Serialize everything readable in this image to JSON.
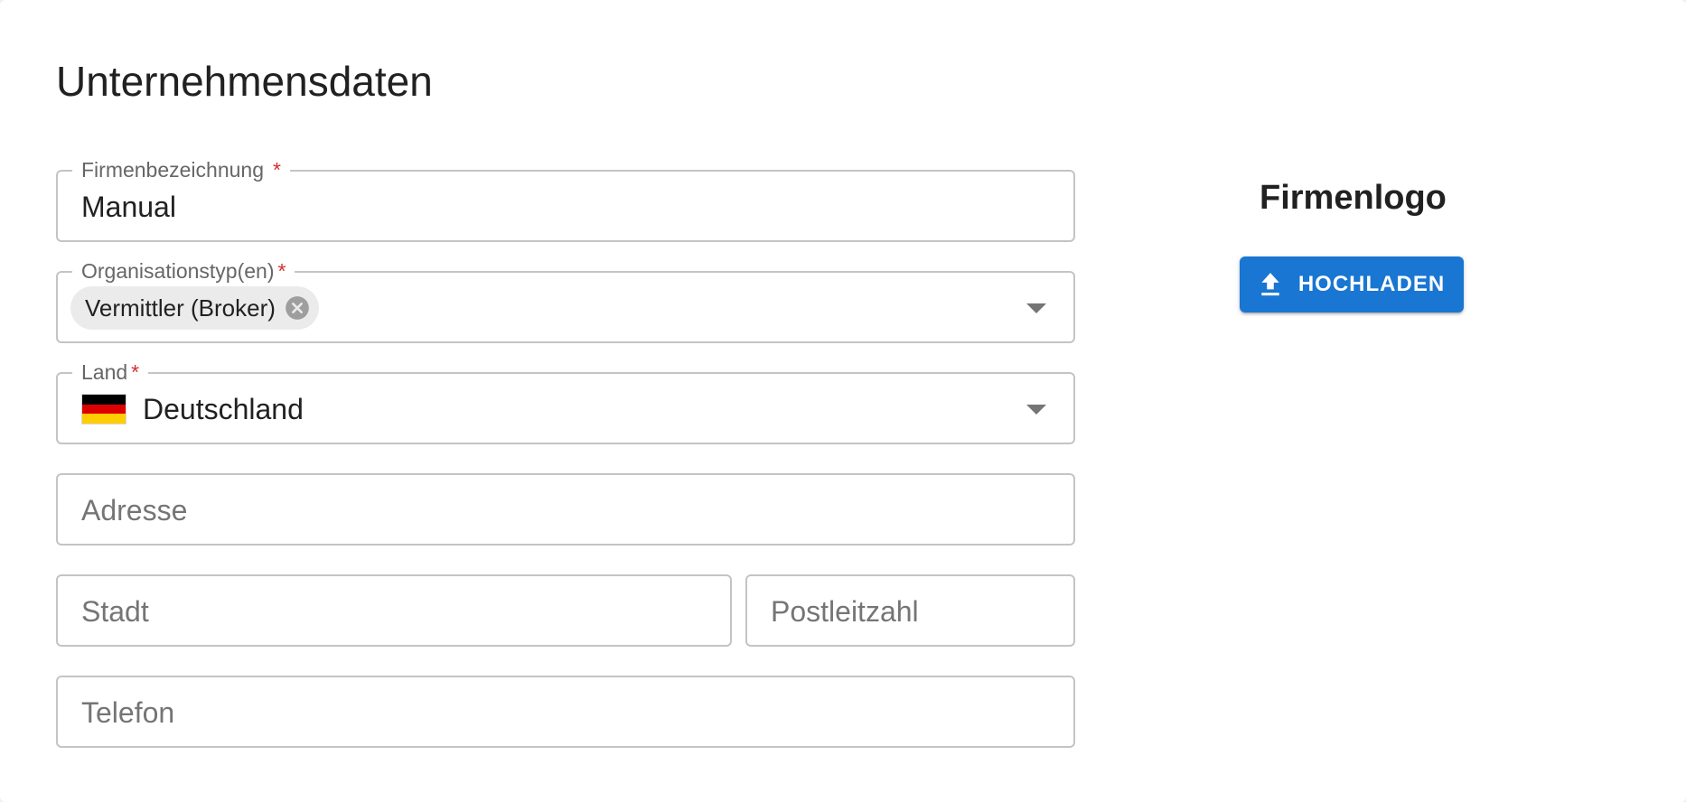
{
  "section": {
    "title": "Unternehmensdaten"
  },
  "fields": {
    "company_name": {
      "label": "Firmenbezeichnung",
      "required_mark": "*",
      "value": "Manual"
    },
    "organization_types": {
      "label": "Organisationstyp(en)",
      "required_mark": "*",
      "chips": [
        "Vermittler (Broker)"
      ]
    },
    "country": {
      "label": "Land",
      "required_mark": "*",
      "value": "Deutschland",
      "flag_icon": "germany-flag-icon"
    },
    "address": {
      "placeholder": "Adresse"
    },
    "city": {
      "placeholder": "Stadt"
    },
    "postal_code": {
      "placeholder": "Postleitzahl"
    },
    "phone": {
      "placeholder": "Telefon"
    }
  },
  "logo": {
    "title": "Firmenlogo",
    "upload_label": "HOCHLADEN",
    "upload_icon": "upload-icon"
  },
  "colors": {
    "primary": "#1976d2",
    "required": "#d32f2f",
    "border": "#c4c4c4",
    "chip_bg": "#ebebeb"
  }
}
